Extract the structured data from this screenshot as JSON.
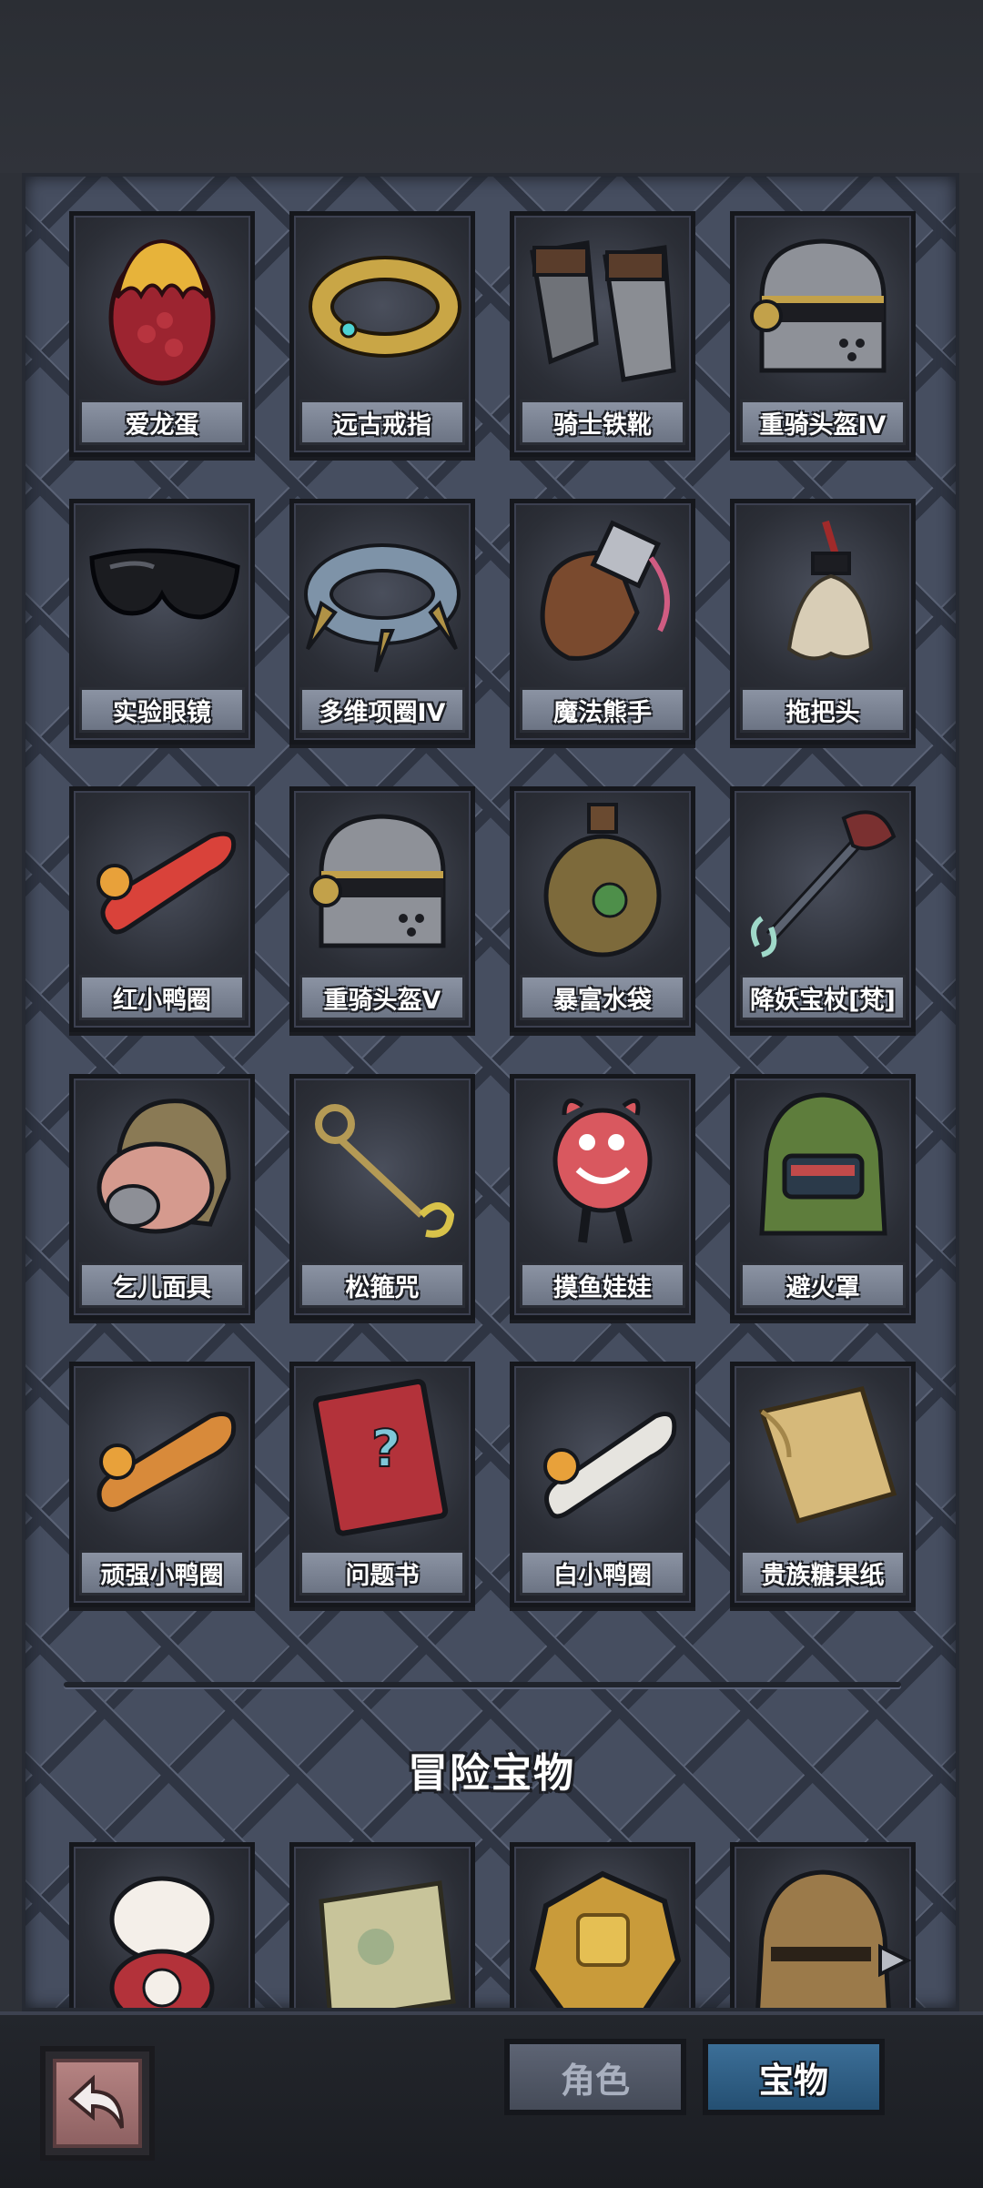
{
  "items": [
    {
      "name": "爱龙蛋",
      "icon": "dragon-egg-icon"
    },
    {
      "name": "远古戒指",
      "icon": "ancient-ring-icon"
    },
    {
      "name": "骑士铁靴",
      "icon": "knight-boots-icon"
    },
    {
      "name": "重骑头盔IV",
      "icon": "heavy-helmet-icon"
    },
    {
      "name": "实验眼镜",
      "icon": "goggles-icon"
    },
    {
      "name": "多维项圈IV",
      "icon": "collar-icon"
    },
    {
      "name": "魔法熊手",
      "icon": "bear-paw-icon"
    },
    {
      "name": "拖把头",
      "icon": "mop-head-icon"
    },
    {
      "name": "红小鸭圈",
      "icon": "red-duck-ring-icon"
    },
    {
      "name": "重骑头盔V",
      "icon": "heavy-helmet-icon"
    },
    {
      "name": "暴富水袋",
      "icon": "water-pouch-icon"
    },
    {
      "name": "降妖宝杖[梵]",
      "icon": "demon-staff-icon"
    },
    {
      "name": "乞儿面具",
      "icon": "beggar-mask-icon"
    },
    {
      "name": "松箍咒",
      "icon": "golden-hoop-icon"
    },
    {
      "name": "摸鱼娃娃",
      "icon": "pink-doll-icon"
    },
    {
      "name": "避火罩",
      "icon": "fire-hood-icon"
    },
    {
      "name": "顽强小鸭圈",
      "icon": "orange-duck-ring-icon"
    },
    {
      "name": "问题书",
      "icon": "question-book-icon"
    },
    {
      "name": "白小鸭圈",
      "icon": "white-duck-ring-icon"
    },
    {
      "name": "贵族糖果纸",
      "icon": "candy-wrapper-icon"
    }
  ],
  "section_title": "冒险宝物",
  "adventure_items": [
    {
      "icon": "lucky-cat-icon"
    },
    {
      "icon": "map-scroll-icon"
    },
    {
      "icon": "gold-coin-icon"
    },
    {
      "icon": "bronze-helmet-icon"
    }
  ],
  "tabs": {
    "role": "角色",
    "treasure": "宝物"
  },
  "colors": {
    "panel": "#464e60",
    "active_tab": "#2f5f86",
    "label_plate": "#7d8595",
    "back_button": "#a67373"
  }
}
